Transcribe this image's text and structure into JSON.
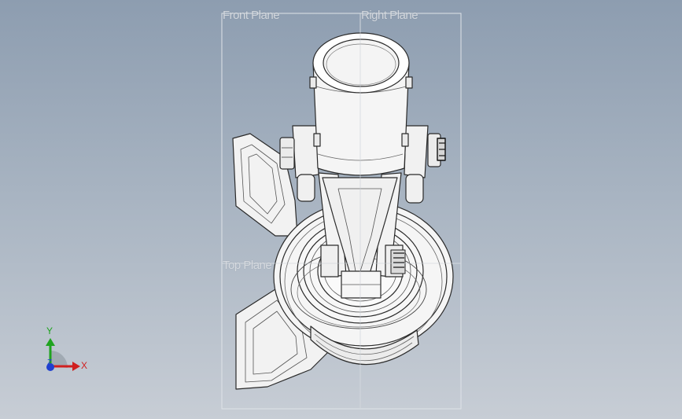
{
  "planes": {
    "front": "Front Plane",
    "right": "Right Plane",
    "top": "Top Plane"
  },
  "triad": {
    "x": "X",
    "y": "Y",
    "z": "Z"
  },
  "colors": {
    "background_top": "#8d9db0",
    "background_bottom": "#c7cdd5",
    "part_fill": "#f4f4f4",
    "edge": "#2a2a2a",
    "plane_border": "#d8dde3",
    "axis_x": "#d02020",
    "axis_y": "#1fa31f",
    "axis_z": "#2040d0"
  }
}
